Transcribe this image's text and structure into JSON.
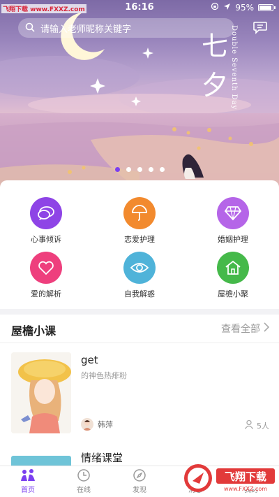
{
  "watermark": "飞翔下载 www.FXXZ.com",
  "status": {
    "time": "16:16",
    "battery": "95%"
  },
  "search": {
    "placeholder": "请输入老师昵称关键字"
  },
  "banner": {
    "title_line1": "七",
    "title_line2": "夕",
    "subtitle": "Double Seventh Day",
    "dot_count": 5,
    "active_dot": 0
  },
  "menu": {
    "items": [
      {
        "label": "心事倾诉",
        "color": "#8e44e6",
        "icon": "chat-bubbles-icon"
      },
      {
        "label": "恋爱护理",
        "color": "#f28a2e",
        "icon": "umbrella-icon"
      },
      {
        "label": "婚姻护理",
        "color": "#b565e8",
        "icon": "diamond-icon"
      },
      {
        "label": "爱的解析",
        "color": "#ee3f7d",
        "icon": "heart-icon"
      },
      {
        "label": "自我解惑",
        "color": "#4fb3d9",
        "icon": "eye-icon"
      },
      {
        "label": "屋檐小聚",
        "color": "#45b94a",
        "icon": "house-icon"
      }
    ]
  },
  "courses": {
    "title": "屋檐小课",
    "see_all": "查看全部",
    "items": [
      {
        "title": "get",
        "desc": "的神色热痱粉",
        "teacher": "韩萍",
        "count": "5人"
      },
      {
        "title": "情绪课堂"
      }
    ]
  },
  "tabs": [
    {
      "label": "首页",
      "icon": "home-people-icon",
      "active": true
    },
    {
      "label": "在线",
      "icon": "clock-icon",
      "active": false
    },
    {
      "label": "发现",
      "icon": "compass-icon",
      "active": false
    },
    {
      "label": "消息",
      "icon": "message-icon",
      "active": false
    },
    {
      "label": "我的",
      "icon": "user-icon",
      "active": false
    }
  ],
  "corner_logo": {
    "text": "飞翔下载",
    "url": "www.FXXZ.com"
  },
  "colors": {
    "accent": "#7b3ff0"
  }
}
